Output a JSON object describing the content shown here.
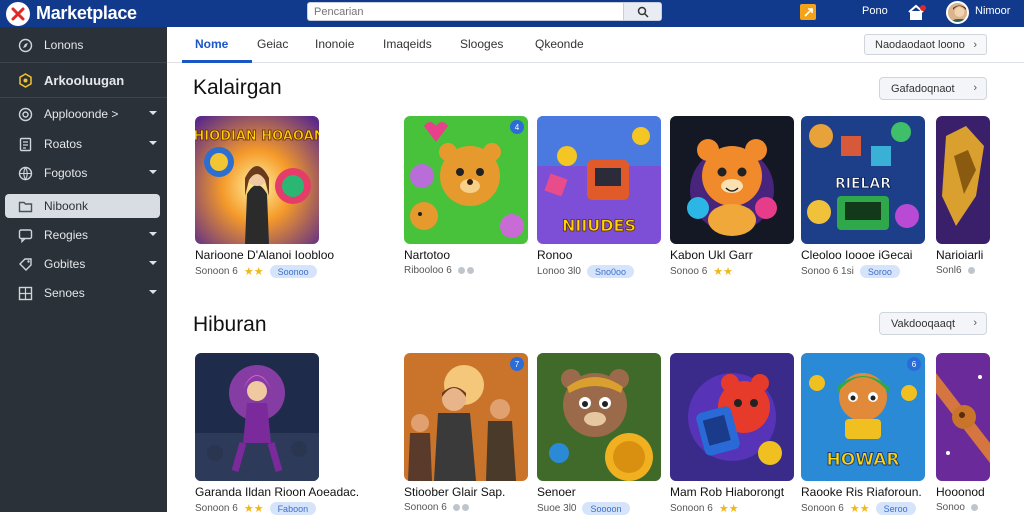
{
  "header": {
    "brand": "Marketplace",
    "search_placeholder": "Pencarian",
    "link": "Pono",
    "username": "Nimoor"
  },
  "sidebar": {
    "items": [
      {
        "label": "Lonons",
        "icon": "compass-icon",
        "chevron": false
      },
      {
        "label": "Arkooluugan",
        "icon": "hexagon-icon",
        "chevron": false,
        "bold": true
      },
      {
        "label": "Applooonde >",
        "icon": "target-icon",
        "chevron": true
      },
      {
        "label": "Roatos",
        "icon": "document-icon",
        "chevron": true
      },
      {
        "label": "Fogotos",
        "icon": "globe-icon",
        "chevron": true
      },
      {
        "label": "Niboonk",
        "icon": "folder-icon",
        "chevron": false,
        "active": true
      },
      {
        "label": "Reogies",
        "icon": "chat-icon",
        "chevron": true
      },
      {
        "label": "Gobites",
        "icon": "tag-icon",
        "chevron": true
      },
      {
        "label": "Senoes",
        "icon": "grid-icon",
        "chevron": true
      }
    ]
  },
  "tabs": {
    "items": [
      "Nome",
      "Geiac",
      "Inonoie",
      "Imaqeids",
      "Slooges",
      "Qkeonde"
    ],
    "right_button": "Naodaodaot loono"
  },
  "sections": [
    {
      "title": "Kalairgan",
      "button": "Gafadoqnaot",
      "cards": [
        {
          "title": "Narioone D'Alanoi Ioobloo",
          "meta": "Sonoon 6",
          "rating": "★★",
          "pill": "Soonoo",
          "thumb": "fantasy-girl",
          "thumb_text": "HIODIAN HOAOAN"
        },
        {
          "title": "Nartotoo",
          "meta": "Ribooloo 6",
          "rating": "",
          "pill": "",
          "thumb": "bear-green",
          "badge": "4"
        },
        {
          "title": "Ronoo",
          "meta": "Lonoo 3l0",
          "rating": "",
          "pill": "Sno0oo",
          "thumb": "arcade",
          "thumb_text": "NIIUDES"
        },
        {
          "title": "Kabon Ukl Garr",
          "meta": "Sonoo 6",
          "rating": "★★",
          "pill": "",
          "thumb": "teddy-neon"
        },
        {
          "title": "Cleoloo Ioooe iGecai",
          "meta": "Sonoo 6 1si",
          "rating": "",
          "pill": "Soroo",
          "thumb": "robots",
          "thumb_text": "RIELAR"
        },
        {
          "title": "Narioiarli",
          "meta": "Sonl6",
          "rating": "",
          "pill": "",
          "thumb": "gold-creature"
        }
      ]
    },
    {
      "title": "Hiburan",
      "button": "Vakdooqaaqt",
      "cards": [
        {
          "title": "Garanda Ildan Rioon Aoeadac.",
          "meta": "Sonoon 6",
          "rating": "★★",
          "pill": "Faboon",
          "thumb": "sorceress"
        },
        {
          "title": "Stioober Glair Sap.",
          "meta": "Sonoon 6",
          "rating": "",
          "pill": "",
          "thumb": "crowd",
          "badge": "7"
        },
        {
          "title": "Senoer",
          "meta": "Suoe 3l0",
          "rating": "",
          "pill": "Soooon",
          "thumb": "bear-coin"
        },
        {
          "title": "Mam Rob Hiaborongt",
          "meta": "Sonoon 6",
          "rating": "★★",
          "pill": "",
          "thumb": "red-creature"
        },
        {
          "title": "Raooke Ris Riaforoun.",
          "meta": "Sonoon 6",
          "rating": "★★",
          "pill": "Seroo",
          "thumb": "hero",
          "thumb_text": "HOWAR",
          "badge": "6"
        },
        {
          "title": "Hooonod",
          "meta": "Sonoo",
          "rating": "",
          "pill": "",
          "thumb": "comet"
        }
      ]
    }
  ],
  "colors": {
    "topbar": "#123a8c",
    "sidebar": "#2b3138",
    "accent": "#1a56c4"
  }
}
